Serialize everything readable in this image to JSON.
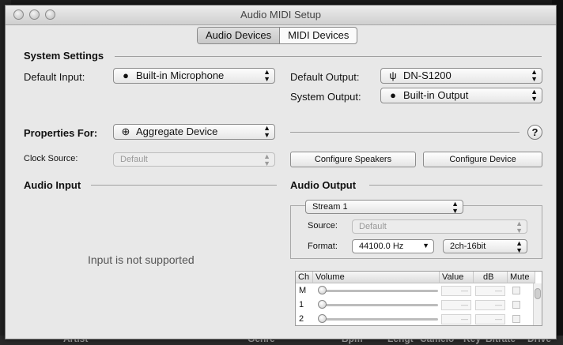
{
  "window": {
    "title": "Audio MIDI Setup"
  },
  "tabs": [
    "Audio Devices",
    "MIDI Devices"
  ],
  "system_settings": {
    "heading": "System Settings",
    "default_input_label": "Default Input:",
    "default_input_value": "Built-in Microphone",
    "default_output_label": "Default Output:",
    "default_output_value": "DN-S1200",
    "system_output_label": "System Output:",
    "system_output_value": "Built-in Output"
  },
  "properties": {
    "label": "Properties For:",
    "value": "Aggregate Device",
    "help": "?",
    "clock_source_label": "Clock Source:",
    "clock_source_value": "Default",
    "configure_speakers": "Configure Speakers",
    "configure_device": "Configure Device"
  },
  "audio_input": {
    "heading": "Audio Input",
    "message": "Input is not supported"
  },
  "audio_output": {
    "heading": "Audio Output",
    "stream": "Stream 1",
    "source_label": "Source:",
    "source_value": "Default",
    "format_label": "Format:",
    "format_rate": "44100.0 Hz",
    "format_bits": "2ch-16bit",
    "columns": [
      "Ch",
      "Volume",
      "Value",
      "dB",
      "Mute"
    ],
    "rows": [
      {
        "ch": "M",
        "value": "—",
        "db": "—"
      },
      {
        "ch": "1",
        "value": "—",
        "db": "—"
      },
      {
        "ch": "2",
        "value": "—",
        "db": "—"
      }
    ]
  },
  "background_columns": [
    "Artist",
    "Genre",
    "Bpm",
    "Lengt",
    "Camelo",
    "Key",
    "Bitrate",
    "Drive"
  ]
}
